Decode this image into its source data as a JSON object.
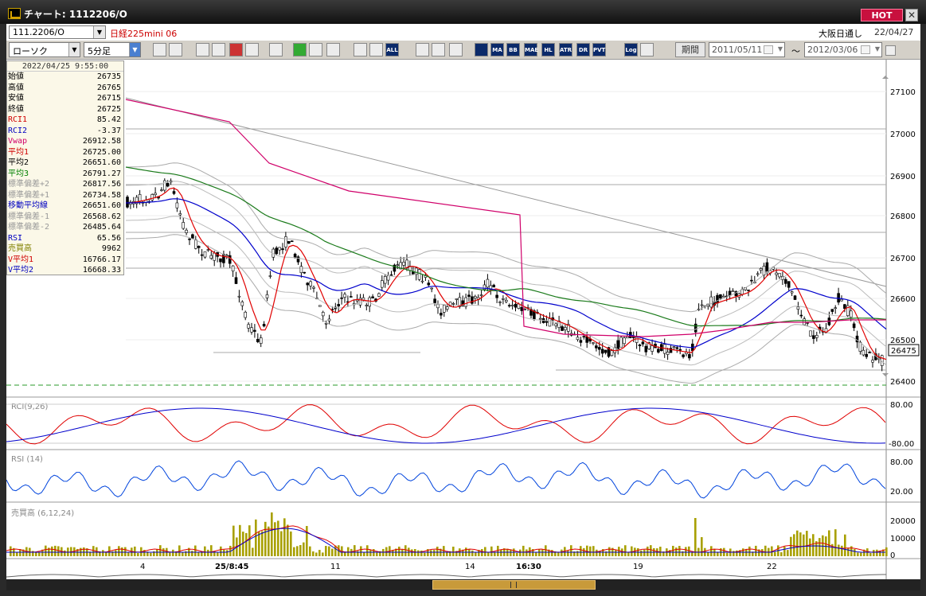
{
  "window": {
    "title": "チャート: 1112206/O",
    "hot_label": "HOT",
    "close_label": "✕"
  },
  "header": {
    "symbol": "111.2206/O",
    "instrument_name": "日経225mini 06",
    "session": "大阪日通し",
    "date": "22/04/27"
  },
  "toolbar": {
    "chart_type": "ローソク",
    "timeframe": "5分足",
    "buttons": [
      "zoom-icon",
      "crosshair-icon",
      "draw-down-icon",
      "search-zoom-icon",
      "candle-up-icon",
      "candle-down-icon",
      "blank-icon",
      "pen-icon",
      "select-icon",
      "redo-icon",
      "single-candle-icon",
      "candles-icon",
      "all-icon",
      "settings-icon",
      "brush-icon",
      "color-icon",
      "ichimoku-icon",
      "ma-icon",
      "bb-icon",
      "mae-icon",
      "hl-icon",
      "atr-icon",
      "dmi-icon",
      "pvt-icon",
      "log-icon",
      "save-icon"
    ],
    "labels": {
      "ma": "MA",
      "bb": "BB",
      "mae": "MAE",
      "hl": "HL",
      "atr": "ATR",
      "dmi": "DR",
      "pvt": "PVT",
      "all": "ALL",
      "log": "Log"
    },
    "period_label": "期間",
    "date_from": "2011/05/11",
    "date_to": "2012/03/06",
    "tilde": "～"
  },
  "info": {
    "timestamp": "2022/04/25  9:55:00",
    "rows": [
      {
        "label": "始値",
        "value": "26735",
        "color": "#000000"
      },
      {
        "label": "高値",
        "value": "26765",
        "color": "#000000"
      },
      {
        "label": "安値",
        "value": "26715",
        "color": "#000000"
      },
      {
        "label": "終値",
        "value": "26725",
        "color": "#000000"
      },
      {
        "label": "RCI1",
        "value": "85.42",
        "color": "#d00000"
      },
      {
        "label": "RCI2",
        "value": "-3.37",
        "color": "#0000c0"
      },
      {
        "label": "Vwap",
        "value": "26912.58",
        "color": "#d0006a"
      },
      {
        "label": "平均1",
        "value": "26725.00",
        "color": "#d00000"
      },
      {
        "label": "平均2",
        "value": "26651.60",
        "color": "#000000"
      },
      {
        "label": "平均3",
        "value": "26791.27",
        "color": "#008000"
      },
      {
        "label": "標準偏差+2",
        "value": "26817.56",
        "color": "#999999"
      },
      {
        "label": "標準偏差+1",
        "value": "26734.58",
        "color": "#999999"
      },
      {
        "label": "移動平均線",
        "value": "26651.60",
        "color": "#0000c0"
      },
      {
        "label": "標準偏差-1",
        "value": "26568.62",
        "color": "#999999"
      },
      {
        "label": "標準偏差-2",
        "value": "26485.64",
        "color": "#999999"
      },
      {
        "label": "RSI",
        "value": "65.56",
        "color": "#0000c0"
      },
      {
        "label": "売買高",
        "value": "9962",
        "color": "#808000"
      },
      {
        "label": "V平均1",
        "value": "16766.17",
        "color": "#d00000"
      },
      {
        "label": "V平均2",
        "value": "16668.33",
        "color": "#0000c0"
      }
    ]
  },
  "chart_data": {
    "type": "candlestick",
    "price_axis": {
      "ticks": [
        "27100",
        "27000",
        "26900",
        "26800",
        "26700",
        "26600",
        "26500",
        "26400"
      ],
      "current_price": "26475"
    },
    "rci_panel": {
      "label": "RCI(9,26)",
      "ticks": [
        "80.00",
        "-80.00"
      ]
    },
    "rsi_panel": {
      "label": "RSI (14)",
      "ticks": [
        "80.00",
        "20.00"
      ]
    },
    "volume_panel": {
      "label": "売買高 (6,12,24)",
      "ticks": [
        "20000",
        "10000",
        "0"
      ]
    },
    "x_labels": [
      {
        "text": "4",
        "bold": false
      },
      {
        "text": "25/8:45",
        "bold": true
      },
      {
        "text": "11",
        "bold": false
      },
      {
        "text": "14",
        "bold": false
      },
      {
        "text": "16:30",
        "bold": true
      },
      {
        "text": "19",
        "bold": false
      },
      {
        "text": "22",
        "bold": false
      }
    ]
  }
}
